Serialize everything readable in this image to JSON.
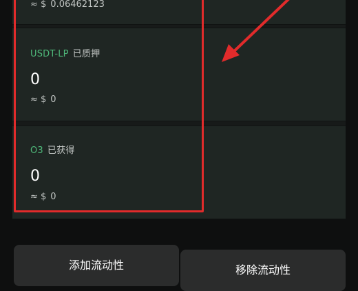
{
  "top_card": {
    "approx_symbol": "≈ $",
    "approx_value": "0.06462123"
  },
  "usdt_card": {
    "token": "USDT-LP",
    "status": "已质押",
    "value": "0",
    "approx_symbol": "≈ $",
    "approx_value": "0"
  },
  "o3_card": {
    "token": "O3",
    "status": "已获得",
    "value": "0",
    "approx_symbol": "≈ $",
    "approx_value": "0"
  },
  "actions": {
    "add_label": "添加流动性",
    "remove_label": "移除流动性"
  },
  "colors": {
    "accent_green": "#4fb97a",
    "highlight_red": "#e12b2b",
    "card_bg": "#1f2623",
    "page_bg": "#0e0f0f"
  }
}
